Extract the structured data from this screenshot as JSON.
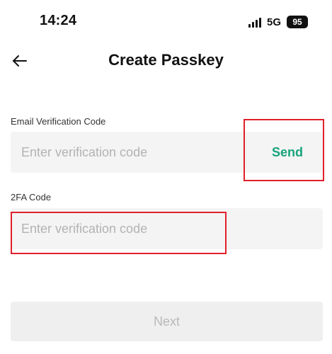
{
  "status_bar": {
    "time": "14:24",
    "network": "5G",
    "battery": "95",
    "signal_icon": "signal-bars-icon"
  },
  "header": {
    "back_icon": "arrow-left-icon",
    "title": "Create Passkey"
  },
  "form": {
    "email_code": {
      "label": "Email Verification Code",
      "value": "",
      "placeholder": "Enter verification code",
      "send_label": "Send"
    },
    "twofa_code": {
      "label": "2FA Code",
      "value": "",
      "placeholder": "Enter verification code"
    },
    "next_label": "Next",
    "next_enabled": false
  },
  "colors": {
    "accent": "#17a379",
    "highlight": "#e0202a",
    "input_bg": "#f4f4f4",
    "disabled_text": "#b8b8b8"
  }
}
